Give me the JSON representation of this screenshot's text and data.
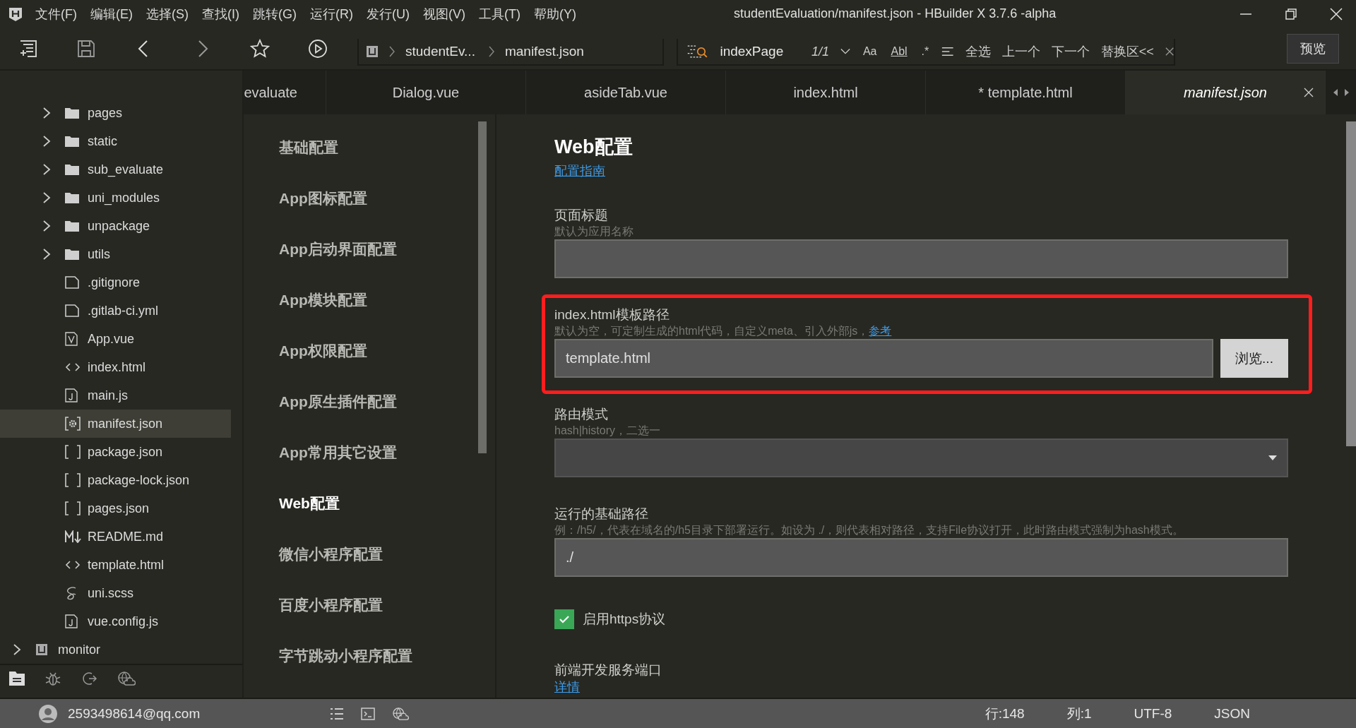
{
  "window": {
    "title": "studentEvaluation/manifest.json - HBuilder X 3.7.6 -alpha",
    "menu": [
      "文件(F)",
      "编辑(E)",
      "选择(S)",
      "查找(I)",
      "跳转(G)",
      "运行(R)",
      "发行(U)",
      "视图(V)",
      "工具(T)",
      "帮助(Y)"
    ]
  },
  "toolbar": {
    "breadcrumb": [
      "studentEv...",
      "manifest.json"
    ],
    "find": {
      "value": "indexPage",
      "count": "1/1",
      "options": [
        {
          "label": "Aa",
          "on": false
        },
        {
          "label": "Abl",
          "on": false
        },
        {
          "label": ".*",
          "on": false
        }
      ],
      "actions": [
        "全选",
        "上一个",
        "下一个",
        "替换区<<"
      ]
    },
    "preview_button": "预览"
  },
  "tabs": [
    {
      "label": "evaluate",
      "selected": false
    },
    {
      "label": "Dialog.vue",
      "selected": false
    },
    {
      "label": "asideTab.vue",
      "selected": false
    },
    {
      "label": "index.html",
      "selected": false
    },
    {
      "label": "* template.html",
      "selected": false
    },
    {
      "label": "manifest.json",
      "selected": true
    }
  ],
  "sidebar": {
    "tree": [
      {
        "label": "pages",
        "kind": "folder",
        "expanded": false,
        "selected": false
      },
      {
        "label": "static",
        "kind": "folder",
        "expanded": false,
        "selected": false
      },
      {
        "label": "sub_evaluate",
        "kind": "folder",
        "expanded": false,
        "selected": false
      },
      {
        "label": "uni_modules",
        "kind": "folder",
        "expanded": false,
        "selected": false
      },
      {
        "label": "unpackage",
        "kind": "folder",
        "expanded": false,
        "selected": false
      },
      {
        "label": "utils",
        "kind": "folder",
        "expanded": false,
        "selected": false
      },
      {
        "label": ".gitignore",
        "kind": "file",
        "selected": false
      },
      {
        "label": ".gitlab-ci.yml",
        "kind": "file",
        "selected": false
      },
      {
        "label": "App.vue",
        "kind": "vue",
        "selected": false
      },
      {
        "label": "index.html",
        "kind": "html",
        "selected": false
      },
      {
        "label": "main.js",
        "kind": "js",
        "selected": false
      },
      {
        "label": "manifest.json",
        "kind": "config",
        "selected": true
      },
      {
        "label": "package.json",
        "kind": "brackets",
        "selected": false
      },
      {
        "label": "package-lock.json",
        "kind": "brackets",
        "selected": false
      },
      {
        "label": "pages.json",
        "kind": "brackets",
        "selected": false
      },
      {
        "label": "README.md",
        "kind": "markdown",
        "selected": false
      },
      {
        "label": "template.html",
        "kind": "html",
        "selected": false
      },
      {
        "label": "uni.scss",
        "kind": "scss",
        "selected": false
      },
      {
        "label": "vue.config.js",
        "kind": "js",
        "selected": false
      },
      {
        "label": "monitor",
        "kind": "project",
        "expanded": false,
        "selected": false
      }
    ]
  },
  "settings_nav": [
    {
      "label": "基础配置",
      "selected": false
    },
    {
      "label": "App图标配置",
      "selected": false
    },
    {
      "label": "App启动界面配置",
      "selected": false
    },
    {
      "label": "App模块配置",
      "selected": false
    },
    {
      "label": "App权限配置",
      "selected": false
    },
    {
      "label": "App原生插件配置",
      "selected": false
    },
    {
      "label": "App常用其它设置",
      "selected": false
    },
    {
      "label": "Web配置",
      "selected": true
    },
    {
      "label": "微信小程序配置",
      "selected": false
    },
    {
      "label": "百度小程序配置",
      "selected": false
    },
    {
      "label": "字节跳动小程序配置",
      "selected": false
    }
  ],
  "form": {
    "title": "Web配置",
    "guide_link": "配置指南",
    "fields": [
      {
        "kind": "text",
        "label": "页面标题",
        "hint": "默认为应用名称"
      },
      {
        "kind": "file",
        "label": "index.html模板路径",
        "hint": "默认为空，可定制生成的html代码，自定义meta、引入外部js，",
        "hint_link": "参考",
        "value": "template.html",
        "button": "浏览...",
        "highlighted": true
      },
      {
        "kind": "select",
        "label": "路由模式",
        "hint": "hash|history，二选一"
      },
      {
        "kind": "text",
        "label": "运行的基础路径",
        "hint": "例：/h5/，代表在域名的/h5目录下部署运行。如设为 ./，则代表相对路径，支持File协议打开，此时路由模式强制为hash模式。",
        "value": "./"
      },
      {
        "kind": "checkbox",
        "label": "启用https协议",
        "checked": true
      },
      {
        "kind": "port",
        "label": "前端开发服务端口",
        "link": "详情"
      }
    ]
  },
  "status_bar": {
    "user": "2593498614@qq.com",
    "line": "行:148",
    "column": "列:1",
    "encoding": "UTF-8",
    "language": "JSON"
  }
}
